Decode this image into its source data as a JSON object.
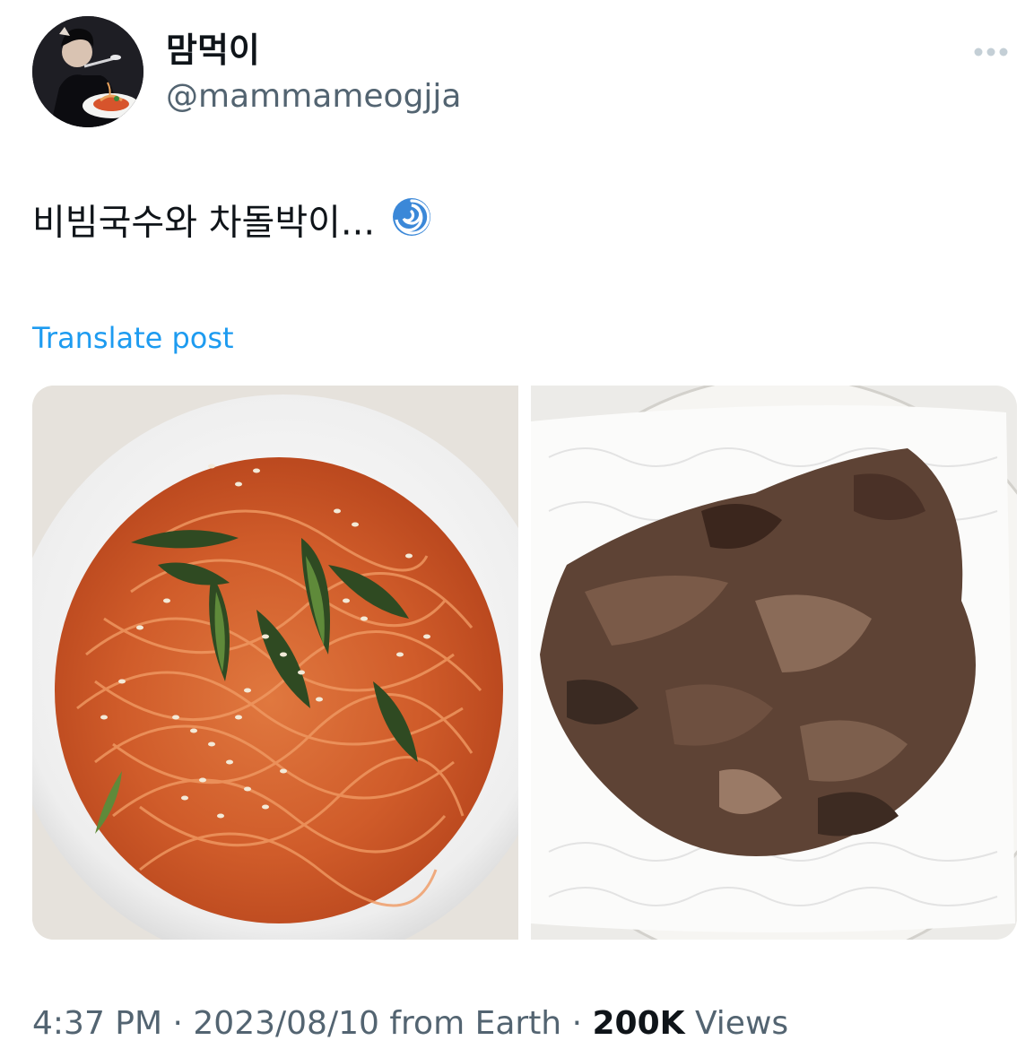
{
  "author": {
    "display_name": "맘먹이",
    "handle": "@mammameogjja"
  },
  "tweet": {
    "text": "비빔국수와 차돌박이...",
    "emoji": "cyclone-emoji",
    "translate_label": "Translate post"
  },
  "media": [
    {
      "name": "bibim-noodles-photo"
    },
    {
      "name": "beef-brisket-photo"
    }
  ],
  "meta": {
    "time": "4:37 PM",
    "separator": " · ",
    "date": "2023/08/10",
    "source": "from Earth",
    "views_count": "200K",
    "views_label": "Views"
  },
  "colors": {
    "accent": "#1d9bf0",
    "secondary_text": "#536471",
    "primary_text": "#0f1419"
  },
  "icons": {
    "more": "more-horizontal-icon"
  }
}
